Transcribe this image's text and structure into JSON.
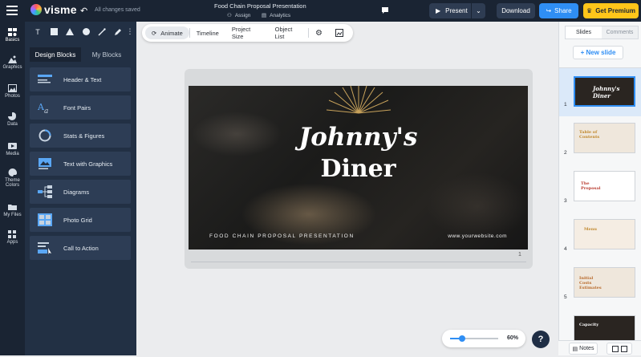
{
  "app": {
    "logo_text": "visme",
    "save_status": "All changes saved",
    "document_title": "Food Chain Proposal Presentation",
    "assign_label": "Assign",
    "analytics_label": "Analytics"
  },
  "header": {
    "present_label": "Present",
    "download_label": "Download",
    "share_label": "Share",
    "premium_label": "Get Premium"
  },
  "left_nav": {
    "items": [
      {
        "label": "Basics",
        "icon": "basics-icon"
      },
      {
        "label": "Graphics",
        "icon": "graphics-icon"
      },
      {
        "label": "Photos",
        "icon": "photos-icon"
      },
      {
        "label": "Data",
        "icon": "data-icon"
      },
      {
        "label": "Media",
        "icon": "media-icon"
      },
      {
        "label": "Theme Colors",
        "icon": "palette-icon"
      },
      {
        "label": "My Files",
        "icon": "folder-icon"
      },
      {
        "label": "Apps",
        "icon": "apps-icon"
      }
    ]
  },
  "panel": {
    "tools": [
      "T"
    ],
    "tabs": [
      "Design Blocks",
      "My Blocks"
    ],
    "blocks": [
      "Header & Text",
      "Font Pairs",
      "Stats & Figures",
      "Text with Graphics",
      "Diagrams",
      "Photo Grid",
      "Call to Action"
    ]
  },
  "canvas_toolbar": {
    "animate": "Animate",
    "timeline": "Timeline",
    "project_size": "Project Size",
    "object_list": "Object List"
  },
  "slide": {
    "title_line1": "Johnny's",
    "title_line2": "Diner",
    "subtitle": "FOOD CHAIN PROPOSAL PRESENTATION",
    "website": "www.yourwebsite.com",
    "page_number": "1"
  },
  "zoom": {
    "value_label": "60%",
    "level": 0.25,
    "help_label": "?"
  },
  "right_panel": {
    "tabs": [
      "Slides",
      "Comments"
    ],
    "new_slide_label": "+ New slide",
    "thumbnails": [
      {
        "num": "1",
        "title": "Johnny's Diner",
        "bg": "#2a2521",
        "color": "#ffffff"
      },
      {
        "num": "2",
        "title": "Table of Contents",
        "bg": "#efe7dc",
        "color": "#c0872b"
      },
      {
        "num": "3",
        "title": "The Proposal",
        "bg": "#ffffff",
        "color": "#b83a2e"
      },
      {
        "num": "4",
        "title": "Menu",
        "bg": "#f5ede3",
        "color": "#c0872b"
      },
      {
        "num": "5",
        "title": "Initial Costs Estimates",
        "bg": "#efe7dc",
        "color": "#b86a2b"
      },
      {
        "num": "6",
        "title": "Capacity",
        "bg": "#2a2521",
        "color": "#ffffff"
      }
    ],
    "notes_label": "Notes"
  }
}
